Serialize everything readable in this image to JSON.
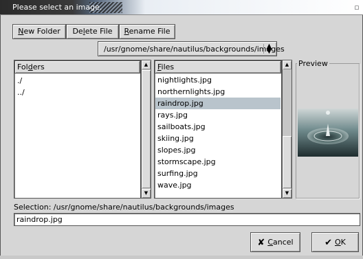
{
  "window": {
    "title": "Please select an image."
  },
  "toolbar": {
    "new_folder_label": "New Folder",
    "new_folder_mnemonic": "N",
    "new_folder_rest": "ew Folder",
    "delete_pre": "De",
    "delete_mnemonic": "l",
    "delete_rest": "ete File",
    "rename_mnemonic": "R",
    "rename_rest": "ename File"
  },
  "path": {
    "value": "/usr/gnome/share/nautilus/backgrounds/images"
  },
  "folders": {
    "header_pre": "Fol",
    "header_mnemonic": "d",
    "header_rest": "ers",
    "items": [
      "./",
      "../"
    ]
  },
  "files": {
    "header_mnemonic": "F",
    "header_rest": "iles",
    "items": [
      "nightlights.jpg",
      "northernlights.jpg",
      "raindrop.jpg",
      "rays.jpg",
      "sailboats.jpg",
      "skiing.jpg",
      "slopes.jpg",
      "stormscape.jpg",
      "surfing.jpg",
      "wave.jpg"
    ],
    "selected_index": 2
  },
  "preview": {
    "label": "Preview"
  },
  "selection": {
    "label": "Selection: /usr/gnome/share/nautilus/backgrounds/images",
    "value": "raindrop.jpg"
  },
  "actions": {
    "cancel_mnemonic": "C",
    "cancel_rest": "ancel",
    "ok_mnemonic": "O",
    "ok_rest": "K"
  },
  "colors": {
    "titlebar_dark": "#2b2b2b",
    "dialog_bg": "#d6d6d6",
    "selected_row": "#b9c4cc"
  }
}
